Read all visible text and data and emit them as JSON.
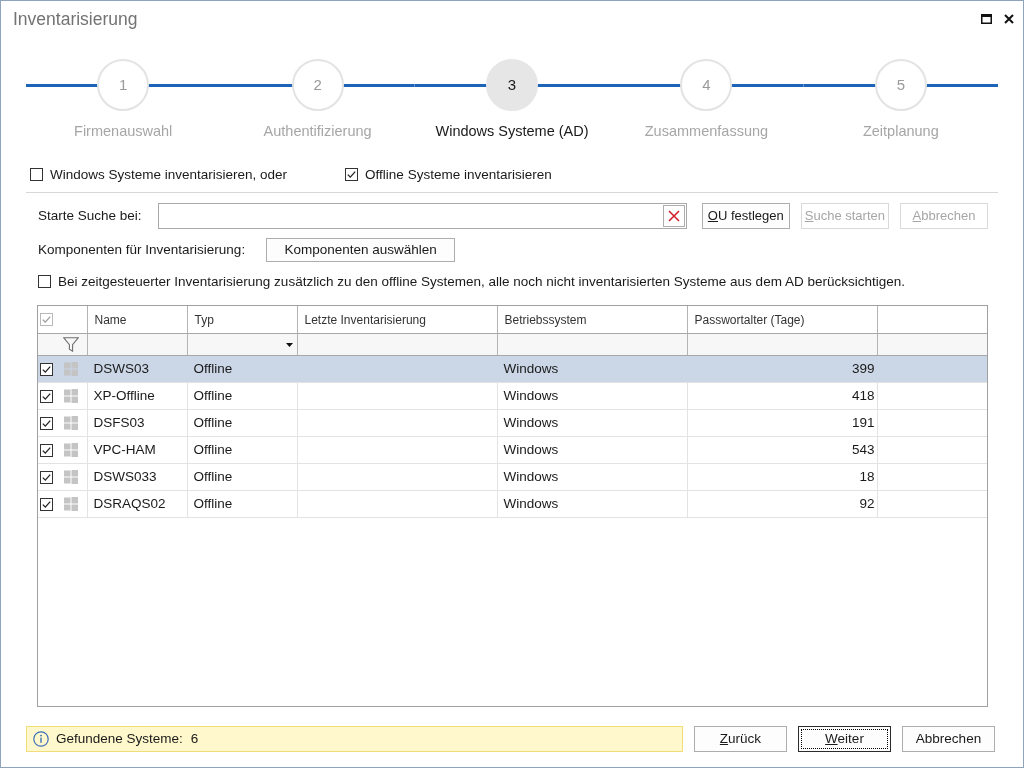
{
  "window": {
    "title": "Inventarisierung"
  },
  "steps": [
    {
      "number": "1",
      "label": "Firmenauswahl",
      "selected": false
    },
    {
      "number": "2",
      "label": "Authentifizierung",
      "selected": false
    },
    {
      "number": "3",
      "label": "Windows Systeme (AD)",
      "selected": true
    },
    {
      "number": "4",
      "label": "Zusammenfassung",
      "selected": false
    },
    {
      "number": "5",
      "label": "Zeitplanung",
      "selected": false
    }
  ],
  "scope_options": [
    {
      "label": "Windows Systeme inventarisieren, oder",
      "checked": false
    },
    {
      "label": "Offline Systeme inventarisieren",
      "checked": true
    }
  ],
  "search": {
    "label": "Starte Suche bei:",
    "buttons": [
      {
        "label": "OU festlegen",
        "mnemonic": true,
        "disabled": false
      },
      {
        "label": "Suche starten",
        "mnemonic": true,
        "disabled": true
      },
      {
        "label": "Abbrechen",
        "mnemonic": true,
        "disabled": true
      }
    ]
  },
  "components": {
    "label": "Komponenten für Inventarisierung:",
    "button": "Komponenten auswählen"
  },
  "schedule_option": {
    "label": "Bei zeitgesteuerter Inventarisierung zusätzlich zu den offline Systemen, alle noch nicht inventarisierten Systeme aus dem AD berücksichtigen.",
    "checked": false
  },
  "table": {
    "header_checkbox": {
      "checked": true,
      "disabled": true
    },
    "columns": [
      {
        "label": "Name",
        "kind": "text"
      },
      {
        "label": "Typ",
        "kind": "dropdown"
      },
      {
        "label": "Letzte Inventarisierung",
        "kind": "text"
      },
      {
        "label": "Betriebssystem",
        "kind": "text"
      },
      {
        "label": "Passwortalter (Tage)",
        "kind": "text"
      }
    ],
    "rows": [
      {
        "checked": true,
        "selected": true,
        "name": "DSWS03",
        "type": "Offline",
        "os": "Windows",
        "password_age": "399"
      },
      {
        "checked": true,
        "selected": false,
        "name": "XP-Offline",
        "type": "Offline",
        "os": "Windows",
        "password_age": "418"
      },
      {
        "checked": true,
        "selected": false,
        "name": "DSFS03",
        "type": "Offline",
        "os": "Windows",
        "password_age": "191"
      },
      {
        "checked": true,
        "selected": false,
        "name": "VPC-HAM",
        "type": "Offline",
        "os": "Windows",
        "password_age": "543"
      },
      {
        "checked": true,
        "selected": false,
        "name": "DSWS033",
        "type": "Offline",
        "os": "Windows",
        "password_age": "18"
      },
      {
        "checked": true,
        "selected": false,
        "name": "DSRAQS02",
        "type": "Offline",
        "os": "Windows",
        "password_age": "92"
      }
    ]
  },
  "footer": {
    "info": {
      "label": "Gefundene Systeme:",
      "count": "6"
    },
    "buttons": [
      {
        "label": "Zurück",
        "mnemonic": true,
        "focused": false
      },
      {
        "label": "Weiter",
        "mnemonic": true,
        "focused": true
      },
      {
        "label": "Abbrechen",
        "mnemonic": false,
        "focused": false
      }
    ]
  }
}
